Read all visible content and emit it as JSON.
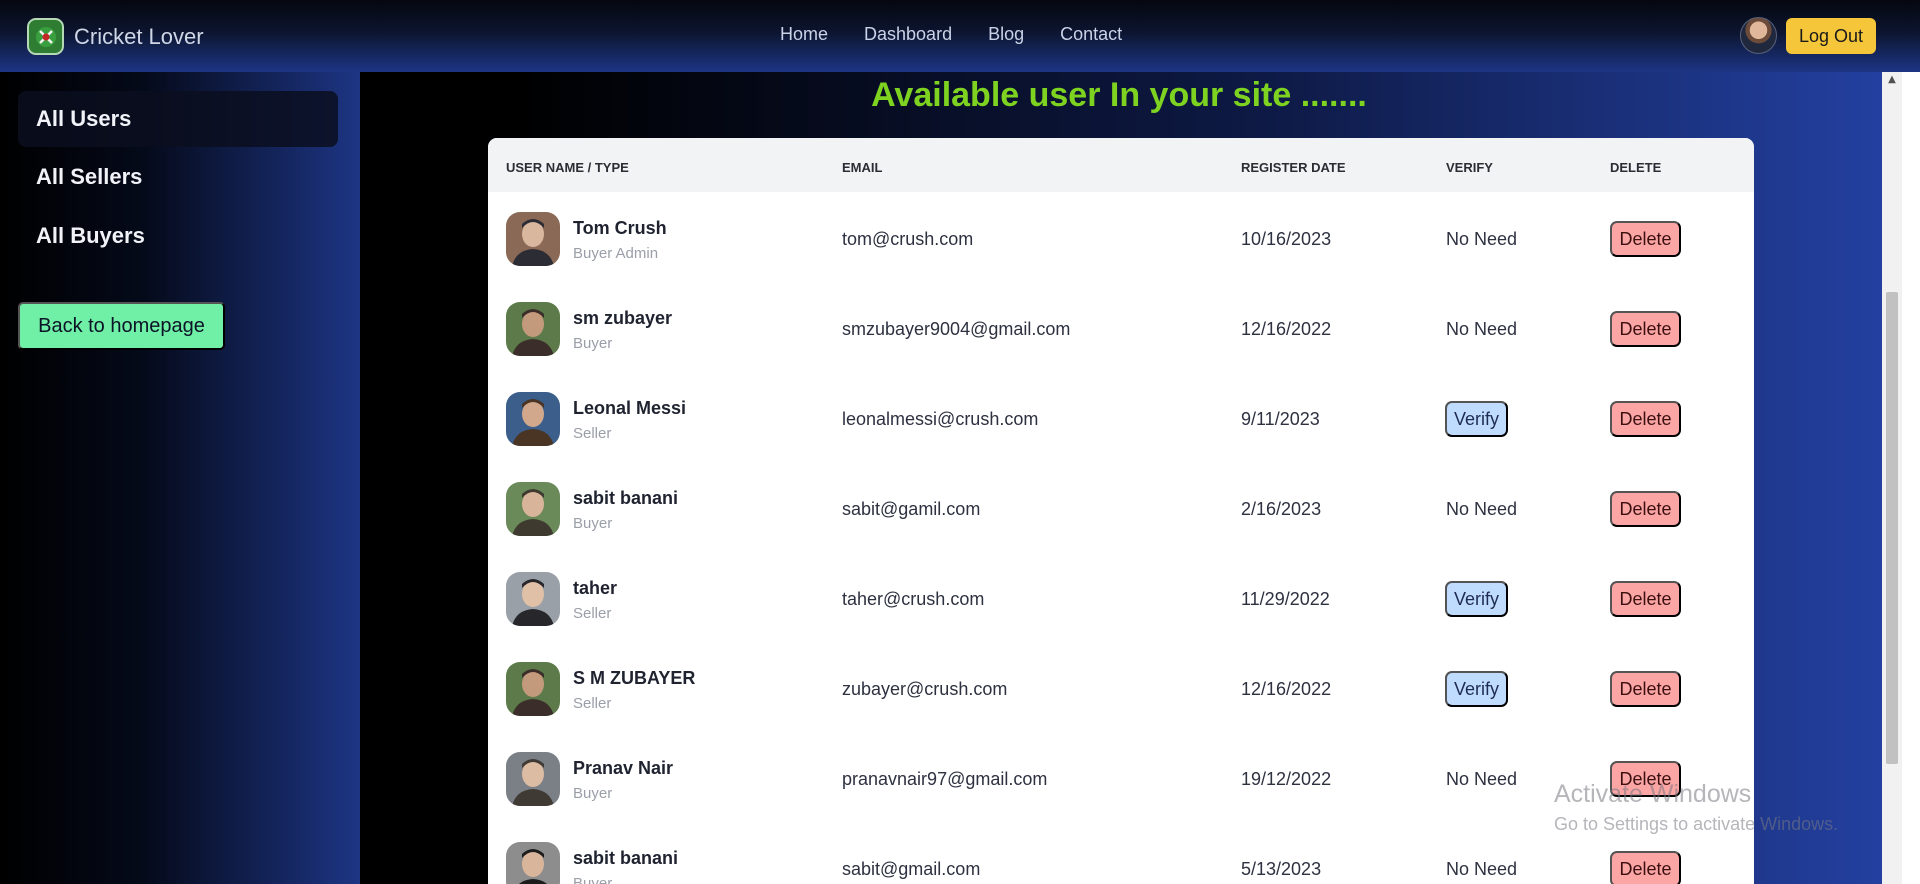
{
  "navbar": {
    "brand": "Cricket Lover",
    "links": [
      "Home",
      "Dashboard",
      "Blog",
      "Contact"
    ],
    "logout_label": "Log Out"
  },
  "sidebar": {
    "items": [
      "All Users",
      "All Sellers",
      "All Buyers"
    ],
    "home_button": "Back to homepage"
  },
  "main": {
    "title": "Available user In your site .......",
    "columns": [
      "USER NAME / TYPE",
      "EMAIL",
      "REGISTER DATE",
      "VERIFY",
      "DELETE"
    ],
    "delete_label": "Delete",
    "rows": [
      {
        "name": "Tom Crush",
        "type": "Buyer Admin",
        "email": "tom@crush.com",
        "date": "10/16/2023",
        "verify": "No Need",
        "verify_is_button": false
      },
      {
        "name": "sm zubayer",
        "type": "Buyer",
        "email": "smzubayer9004@gmail.com",
        "date": "12/16/2022",
        "verify": "No Need",
        "verify_is_button": false
      },
      {
        "name": "Leonal Messi",
        "type": "Seller",
        "email": "leonalmessi@crush.com",
        "date": "9/11/2023",
        "verify": "Verify",
        "verify_is_button": true
      },
      {
        "name": "sabit banani",
        "type": "Buyer",
        "email": "sabit@gamil.com",
        "date": "2/16/2023",
        "verify": "No Need",
        "verify_is_button": false
      },
      {
        "name": "taher",
        "type": "Seller",
        "email": "taher@crush.com",
        "date": "11/29/2022",
        "verify": "Verify",
        "verify_is_button": true
      },
      {
        "name": "S M ZUBAYER",
        "type": "Seller",
        "email": "zubayer@crush.com",
        "date": "12/16/2022",
        "verify": "Verify",
        "verify_is_button": true
      },
      {
        "name": "Pranav Nair",
        "type": "Buyer",
        "email": "pranavnair97@gmail.com",
        "date": "19/12/2022",
        "verify": "No Need",
        "verify_is_button": false
      },
      {
        "name": "sabit banani",
        "type": "Buyer",
        "email": "sabit@gmail.com",
        "date": "5/13/2023",
        "verify": "No Need",
        "verify_is_button": false
      }
    ]
  },
  "watermark": {
    "title": "Activate Windows",
    "subtitle": "Go to Settings to activate Windows."
  },
  "colors": {
    "title_green": "#7ed321",
    "verify_blue": "#bfdbfe",
    "delete_red": "#fca5a5",
    "logout_yellow": "#f5c63a",
    "home_green": "#6ff0a6"
  },
  "icons": {
    "brand": "cricket-logo-icon",
    "user_avatar": "user-avatar-icon"
  }
}
